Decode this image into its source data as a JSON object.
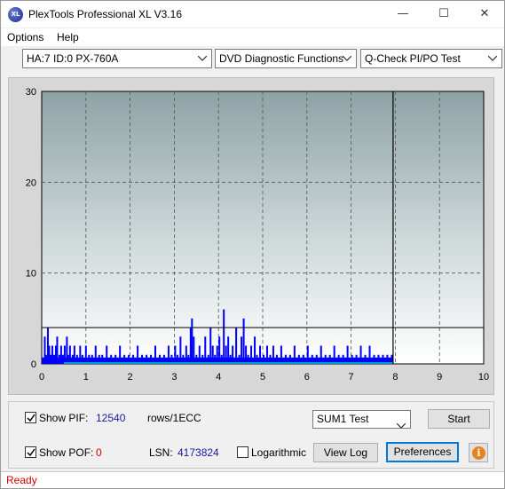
{
  "window": {
    "title": "PlexTools Professional XL V3.16",
    "icon_label": "XL",
    "minimize_glyph": "—",
    "maximize_glyph": "☐",
    "close_glyph": "✕"
  },
  "menu": {
    "options": "Options",
    "help": "Help"
  },
  "toolbar": {
    "drive": "HA:7 ID:0  PX-760A",
    "function": "DVD Diagnostic Functions",
    "test": "Q-Check PI/PO Test"
  },
  "chart_data": {
    "type": "bar",
    "title": "",
    "xlabel": "",
    "ylabel": "",
    "xlim": [
      0,
      10
    ],
    "ylim": [
      0,
      30
    ],
    "x_ticks": [
      "0",
      "1",
      "2",
      "3",
      "4",
      "5",
      "6",
      "7",
      "8",
      "9",
      "10"
    ],
    "y_ticks": [
      "0",
      "10",
      "20",
      "30"
    ],
    "threshold_line": 4,
    "end_marker_x": 7.95,
    "grid": true,
    "colors": {
      "pif": "#0000ff",
      "pof": "#00c8c8",
      "threshold": "#000000"
    },
    "series": [
      {
        "name": "PIF",
        "points": [
          [
            0.05,
            3
          ],
          [
            0.08,
            1
          ],
          [
            0.12,
            4
          ],
          [
            0.15,
            2
          ],
          [
            0.18,
            1
          ],
          [
            0.22,
            2
          ],
          [
            0.26,
            1
          ],
          [
            0.3,
            2
          ],
          [
            0.33,
            3
          ],
          [
            0.38,
            1
          ],
          [
            0.42,
            2
          ],
          [
            0.46,
            1
          ],
          [
            0.5,
            2
          ],
          [
            0.55,
            3
          ],
          [
            0.58,
            1
          ],
          [
            0.62,
            2
          ],
          [
            0.68,
            1
          ],
          [
            0.72,
            2
          ],
          [
            0.78,
            1
          ],
          [
            0.85,
            2
          ],
          [
            0.9,
            1
          ],
          [
            0.98,
            2
          ],
          [
            1.05,
            1
          ],
          [
            1.12,
            1
          ],
          [
            1.2,
            2
          ],
          [
            1.28,
            1
          ],
          [
            1.35,
            1
          ],
          [
            1.45,
            2
          ],
          [
            1.55,
            1
          ],
          [
            1.65,
            1
          ],
          [
            1.75,
            2
          ],
          [
            1.85,
            1
          ],
          [
            1.95,
            1
          ],
          [
            2.05,
            1
          ],
          [
            2.15,
            2
          ],
          [
            2.25,
            1
          ],
          [
            2.35,
            1
          ],
          [
            2.45,
            1
          ],
          [
            2.55,
            2
          ],
          [
            2.65,
            1
          ],
          [
            2.75,
            1
          ],
          [
            2.85,
            2
          ],
          [
            2.92,
            1
          ],
          [
            3.0,
            2
          ],
          [
            3.05,
            1
          ],
          [
            3.12,
            3
          ],
          [
            3.18,
            1
          ],
          [
            3.25,
            2
          ],
          [
            3.3,
            1
          ],
          [
            3.35,
            4
          ],
          [
            3.38,
            5
          ],
          [
            3.42,
            3
          ],
          [
            3.48,
            1
          ],
          [
            3.55,
            2
          ],
          [
            3.62,
            1
          ],
          [
            3.68,
            3
          ],
          [
            3.75,
            1
          ],
          [
            3.8,
            4
          ],
          [
            3.85,
            2
          ],
          [
            3.9,
            1
          ],
          [
            3.95,
            2
          ],
          [
            4.0,
            3
          ],
          [
            4.05,
            1
          ],
          [
            4.1,
            6
          ],
          [
            4.15,
            2
          ],
          [
            4.2,
            3
          ],
          [
            4.25,
            1
          ],
          [
            4.3,
            2
          ],
          [
            4.38,
            4
          ],
          [
            4.45,
            1
          ],
          [
            4.5,
            3
          ],
          [
            4.55,
            5
          ],
          [
            4.6,
            2
          ],
          [
            4.65,
            1
          ],
          [
            4.72,
            2
          ],
          [
            4.8,
            3
          ],
          [
            4.85,
            1
          ],
          [
            4.92,
            2
          ],
          [
            5.0,
            1
          ],
          [
            5.08,
            2
          ],
          [
            5.15,
            1
          ],
          [
            5.22,
            2
          ],
          [
            5.3,
            1
          ],
          [
            5.4,
            2
          ],
          [
            5.5,
            1
          ],
          [
            5.6,
            1
          ],
          [
            5.7,
            2
          ],
          [
            5.8,
            1
          ],
          [
            5.9,
            1
          ],
          [
            6.0,
            2
          ],
          [
            6.1,
            1
          ],
          [
            6.2,
            1
          ],
          [
            6.3,
            2
          ],
          [
            6.4,
            1
          ],
          [
            6.5,
            1
          ],
          [
            6.6,
            2
          ],
          [
            6.7,
            1
          ],
          [
            6.8,
            1
          ],
          [
            6.9,
            2
          ],
          [
            7.0,
            1
          ],
          [
            7.1,
            1
          ],
          [
            7.2,
            2
          ],
          [
            7.3,
            1
          ],
          [
            7.4,
            2
          ],
          [
            7.5,
            1
          ],
          [
            7.6,
            1
          ],
          [
            7.7,
            1
          ],
          [
            7.8,
            1
          ],
          [
            7.9,
            1
          ]
        ]
      },
      {
        "name": "POF",
        "total": 0
      }
    ]
  },
  "bottom": {
    "show_pif_label": "Show PIF:",
    "pif_value": "12540",
    "pif_unit": "rows/1ECC",
    "show_pof_label": "Show POF:",
    "pof_value": "0",
    "lsn_label": "LSN:",
    "lsn_value": "4173824",
    "logarithmic_label": "Logarithmic",
    "sum_select": "SUM1 Test",
    "start_button": "Start",
    "view_log_button": "View Log",
    "preferences_button": "Preferences",
    "info_glyph": "i"
  },
  "status": {
    "text": "Ready"
  }
}
